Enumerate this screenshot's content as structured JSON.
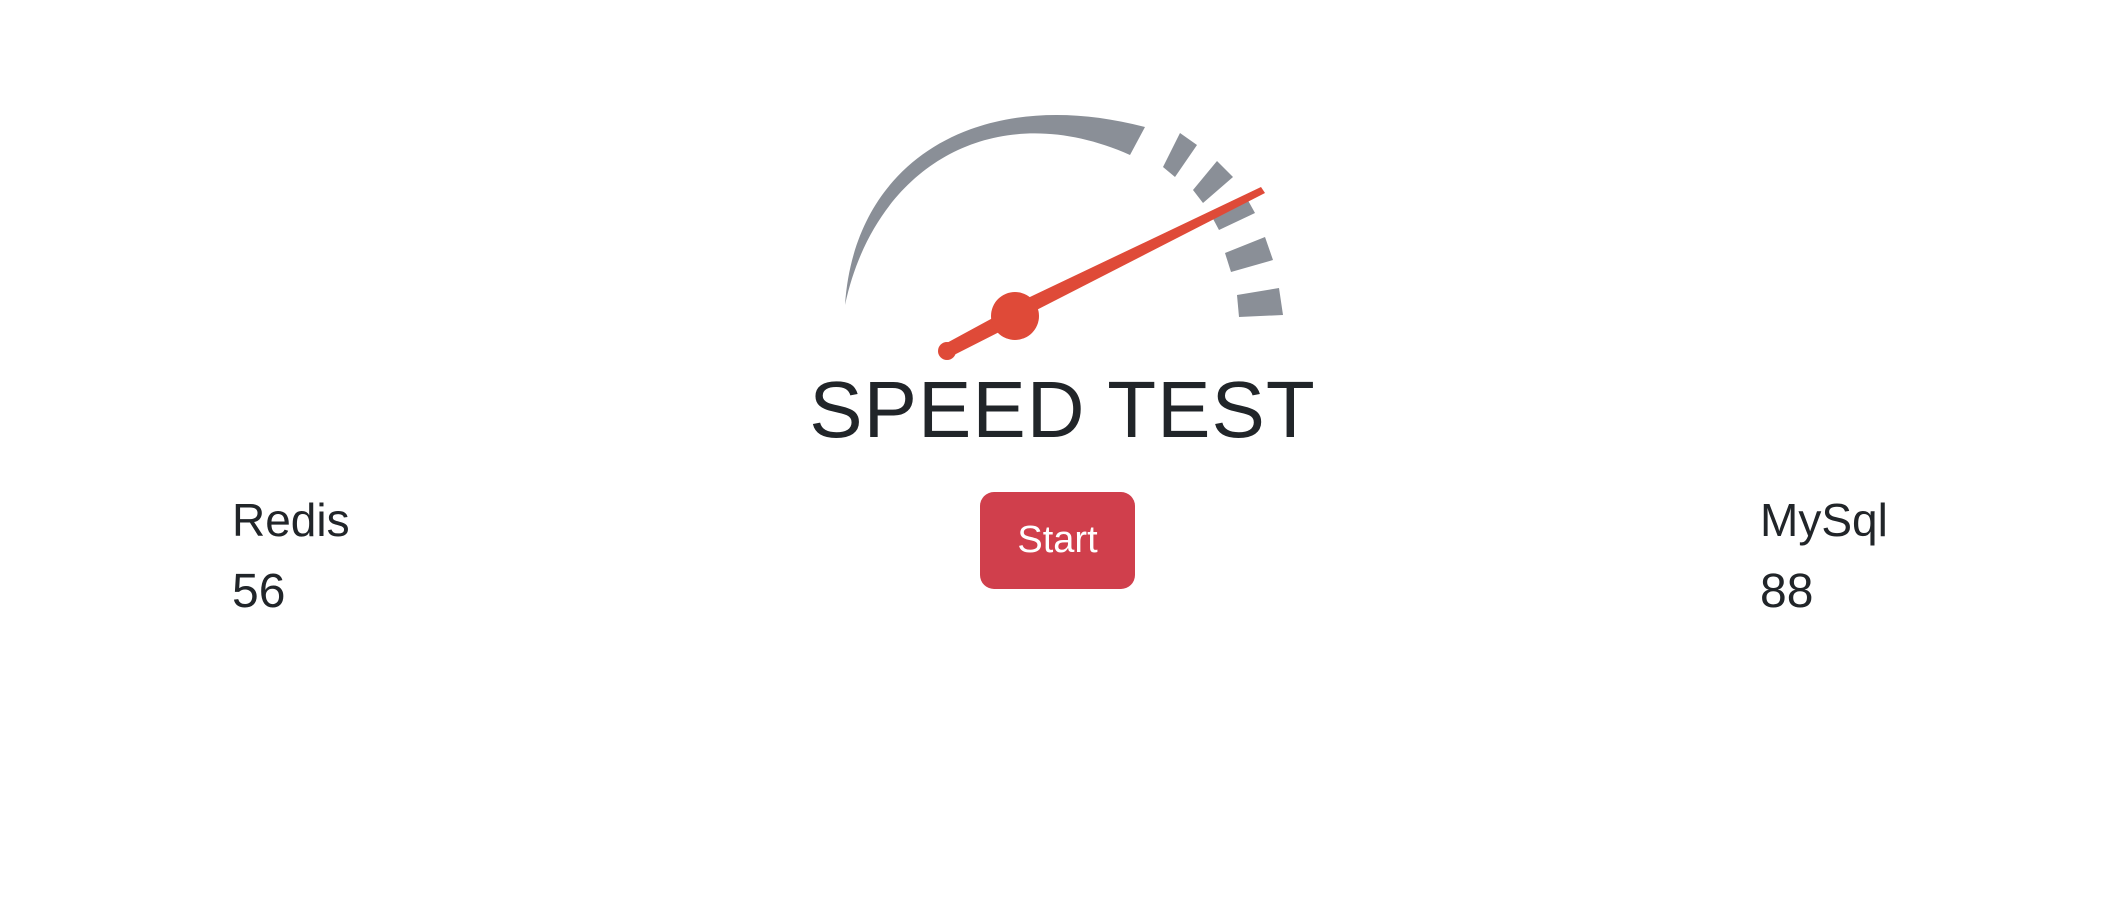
{
  "header": {
    "title": "SPEED TEST"
  },
  "gauge": {
    "icon": "speedometer-icon",
    "needle_value": 0.78,
    "arc_color": "#8a8f97",
    "needle_color": "#df4a38"
  },
  "stats": {
    "left": {
      "label": "Redis",
      "value": "56"
    },
    "right": {
      "label": "MySql",
      "value": "88"
    }
  },
  "controls": {
    "start_label": "Start",
    "start_color": "#d03f4c"
  }
}
